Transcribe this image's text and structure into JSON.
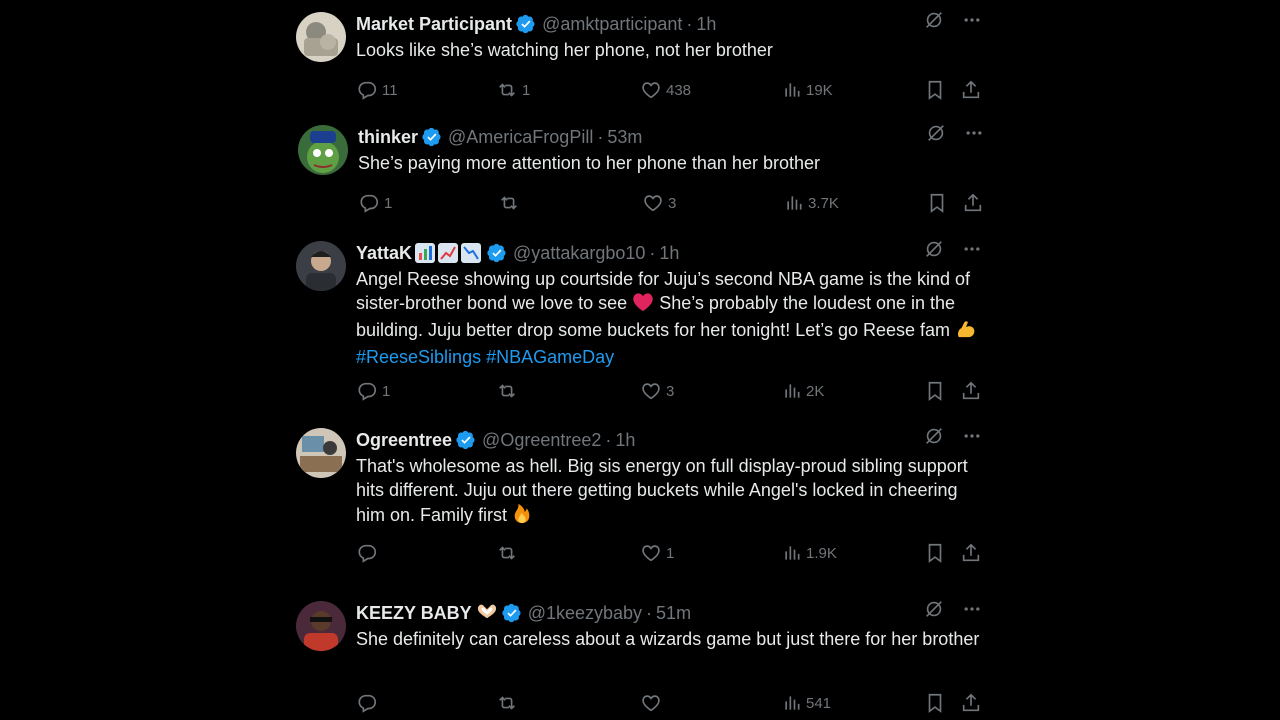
{
  "replies": [
    {
      "name": "Market Participant",
      "handle": "@amktparticipant",
      "time": "1h",
      "text": "Looks like she’s watching her phone, not her brother",
      "replies": "11",
      "reposts": "1",
      "likes": "438",
      "views": "19K"
    },
    {
      "name": "thinker",
      "handle": "@AmericaFrogPill",
      "time": "53m",
      "text": "She’s paying more attention to her phone than her brother",
      "replies": "1",
      "reposts": "",
      "likes": "3",
      "views": "3.7K"
    },
    {
      "name": "YattaK",
      "handle": "@yattakargbo10",
      "time": "1h",
      "text_a": "Angel Reese showing up courtside for Juju’s second NBA game is the kind of sister-brother bond we love to see",
      "text_b": "She’s probably the loudest one in the building. Juju better drop some buckets for her tonight! Let’s go Reese fam",
      "hashtags": "#ReeseSiblings #NBAGameDay",
      "replies": "1",
      "reposts": "",
      "likes": "3",
      "views": "2K"
    },
    {
      "name": "Ogreentree",
      "handle": "@Ogreentree2",
      "time": "1h",
      "text": "That's wholesome as hell. Big sis energy on full display-proud sibling support hits different. Juju out there getting buckets while Angel's locked in cheering him on. Family first",
      "replies": "",
      "reposts": "",
      "likes": "1",
      "views": "1.9K"
    },
    {
      "name": "KEEZY BABY",
      "handle": "@1keezybaby",
      "time": "51m",
      "text": "She definitely can careless about a wizards game but just there for her brother",
      "replies": "",
      "reposts": "",
      "likes": "",
      "views": "541"
    }
  ],
  "colors": {
    "background": "#000000",
    "text": "#e7e9ea",
    "muted": "#71767b",
    "link": "#1d9bf0",
    "verified": "#1d9bf0"
  }
}
